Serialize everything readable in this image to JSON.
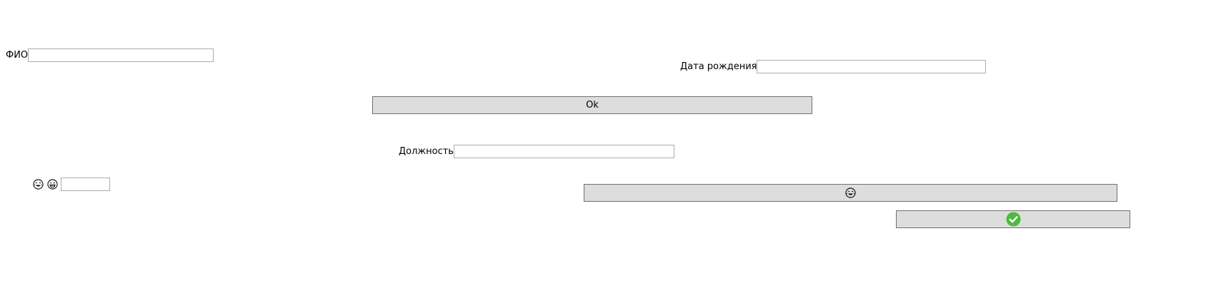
{
  "form": {
    "fio_label": "ФИО",
    "fio_value": "",
    "birth_label": "Дата рождения",
    "birth_value": "",
    "ok_label": "Ok",
    "position_label": "Должность",
    "position_value": "",
    "emoji_field_value": "",
    "emoji_labels": [
      "crying-laughing-face-icon",
      "grinning-face-icon"
    ],
    "emoji_button_icon": "crying-laughing-face-icon",
    "confirm_button_icon": "check-mark-icon"
  },
  "colors": {
    "button_bg": "#dddddd",
    "button_border": "#707070",
    "input_border": "#abadb3",
    "check_green": "#4cba3e"
  }
}
